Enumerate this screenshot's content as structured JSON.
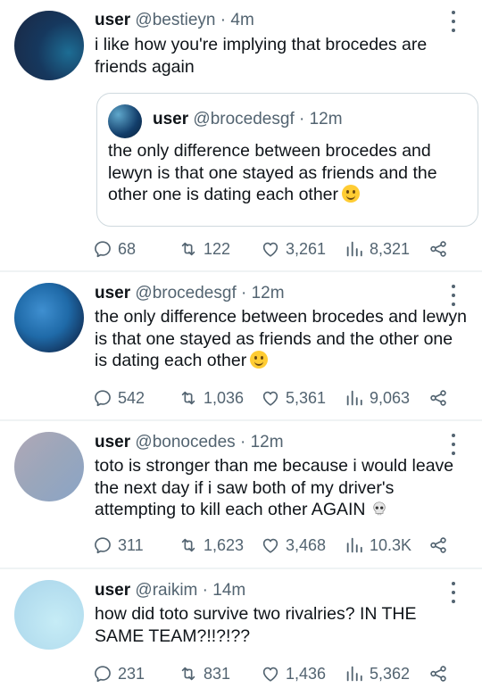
{
  "tweets": [
    {
      "name": "user",
      "handle": "@bestieyn",
      "sep": "·",
      "time": "4m",
      "text": "i like how you're implying that brocedes are friends again",
      "quote": {
        "name": "user",
        "handle": "@brocedesgf",
        "sep": "·",
        "time": "12m",
        "text": "the only difference between brocedes and lewyn is that one stayed as friends and the other one is dating each other"
      },
      "replies": "68",
      "retweets": "122",
      "likes": "3,261",
      "views": "8,321"
    },
    {
      "name": "user",
      "handle": "@brocedesgf",
      "sep": "·",
      "time": "12m",
      "text": "the only difference between brocedes and lewyn is that one stayed as friends and the other one is dating each other",
      "replies": "542",
      "retweets": "1,036",
      "likes": "5,361",
      "views": "9,063"
    },
    {
      "name": "user",
      "handle": "@bonocedes",
      "sep": "·",
      "time": "12m",
      "text": "toto is stronger than me because i would leave the next day if i saw both of my driver's attempting to kill each other AGAIN",
      "replies": "311",
      "retweets": "1,623",
      "likes": "3,468",
      "views": "10.3K"
    },
    {
      "name": "user",
      "handle": "@raikim",
      "sep": "·",
      "time": "14m",
      "text": "how did toto survive two rivalries? IN THE SAME TEAM?!!?!??",
      "replies": "231",
      "retweets": "831",
      "likes": "1,436",
      "views": "5,362"
    }
  ],
  "icons": {
    "reply": "reply-icon",
    "retweet": "retweet-icon",
    "like": "heart-icon",
    "views": "views-icon",
    "share": "share-icon",
    "more": "more-icon",
    "emoji": "slightly-smiling-face-emoji",
    "skull": "skull-emoji"
  },
  "colors": {
    "text": "#0f1419",
    "secondary": "#536471",
    "divider": "#eff3f4",
    "border": "#cfd9de"
  }
}
